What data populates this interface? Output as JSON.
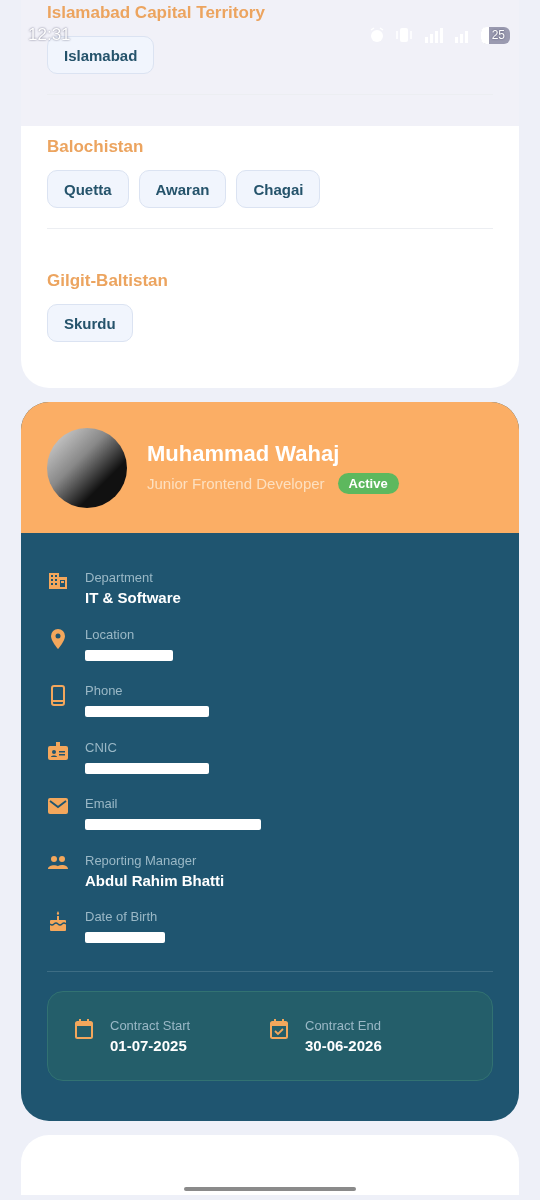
{
  "status_bar": {
    "time": "12:31",
    "battery": "25"
  },
  "regions": [
    {
      "name": "Islamabad Capital Territory",
      "cities": [
        "Islamabad"
      ]
    },
    {
      "name": "Balochistan",
      "cities": [
        "Quetta",
        "Awaran",
        "Chagai"
      ]
    },
    {
      "name": "Gilgit-Baltistan",
      "cities": [
        "Skurdu"
      ]
    }
  ],
  "profile": {
    "name": "Muhammad Wahaj",
    "role": "Junior Frontend Developer",
    "status": "Active",
    "details": [
      {
        "label": "Department",
        "value": "IT & Software",
        "redacted": false
      },
      {
        "label": "Location",
        "redacted": true
      },
      {
        "label": "Phone",
        "redacted": true
      },
      {
        "label": "CNIC",
        "redacted": true
      },
      {
        "label": "Email",
        "redacted": true
      },
      {
        "label": "Reporting Manager",
        "value": "Abdul Rahim Bhatti",
        "redacted": false
      },
      {
        "label": "Date of Birth",
        "redacted": true
      }
    ],
    "contract": [
      {
        "label": "Contract Start",
        "value": "01-07-2025"
      },
      {
        "label": "Contract End",
        "value": "30-06-2026"
      }
    ]
  }
}
